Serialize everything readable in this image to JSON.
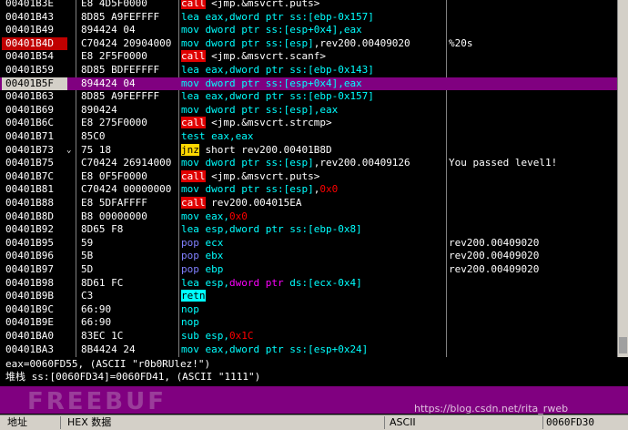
{
  "disasm": [
    {
      "addr": "00401B3E",
      "hex": "E8 4D5F0000",
      "ins": [
        [
          "k-call",
          "call"
        ],
        [
          "t",
          " <jmp.&msvcrt.puts>"
        ]
      ],
      "cmt": ""
    },
    {
      "addr": "00401B43",
      "hex": "8D85 A9FEFFFF",
      "ins": [
        [
          "k-lea",
          "lea"
        ],
        [
          "reg",
          " eax,dword ptr ss:[ebp-0x157]"
        ]
      ],
      "cmt": ""
    },
    {
      "addr": "00401B49",
      "hex": "894424 04",
      "ins": [
        [
          "k",
          "mov"
        ],
        [
          "reg",
          " dword ptr ss:[esp+0x4],eax"
        ]
      ],
      "cmt": ""
    },
    {
      "addr": "00401B4D",
      "hex": "C70424 20904000",
      "ins": [
        [
          "k",
          "mov"
        ],
        [
          "reg",
          " dword ptr ss:[esp]"
        ],
        [
          "t",
          ",rev200.00409020"
        ]
      ],
      "cmt": "%20s",
      "bp": true
    },
    {
      "addr": "00401B54",
      "hex": "E8 2F5F0000",
      "ins": [
        [
          "k-call",
          "call"
        ],
        [
          "t",
          " <jmp.&msvcrt.scanf>"
        ]
      ],
      "cmt": ""
    },
    {
      "addr": "00401B59",
      "hex": "8D85 BDFEFFFF",
      "ins": [
        [
          "k-lea",
          "lea"
        ],
        [
          "reg",
          " eax,dword ptr ss:[ebp-0x143]"
        ]
      ],
      "cmt": ""
    },
    {
      "addr": "00401B5F",
      "hex": "894424 04",
      "ins": [
        [
          "k",
          "mov"
        ],
        [
          "reg",
          " dword ptr ss:[esp+0x4],eax"
        ]
      ],
      "cmt": "",
      "sel": true,
      "cur": true
    },
    {
      "addr": "00401B63",
      "hex": "8D85 A9FEFFFF",
      "ins": [
        [
          "k-lea",
          "lea"
        ],
        [
          "reg",
          " eax,dword ptr ss:[ebp-0x157]"
        ]
      ],
      "cmt": ""
    },
    {
      "addr": "00401B69",
      "hex": "890424",
      "ins": [
        [
          "k",
          "mov"
        ],
        [
          "reg",
          " dword ptr ss:[esp],eax"
        ]
      ],
      "cmt": ""
    },
    {
      "addr": "00401B6C",
      "hex": "E8 275F0000",
      "ins": [
        [
          "k-call",
          "call"
        ],
        [
          "t",
          " <jmp.&msvcrt.strcmp>"
        ]
      ],
      "cmt": ""
    },
    {
      "addr": "00401B71",
      "hex": "85C0",
      "ins": [
        [
          "k",
          "test"
        ],
        [
          "reg",
          " eax,eax"
        ]
      ],
      "cmt": ""
    },
    {
      "addr": "00401B73",
      "hex": "75 18",
      "arrow": "⌄",
      "ins": [
        [
          "k-jmp",
          "jnz"
        ],
        [
          "t",
          " short rev200.00401B8D"
        ]
      ],
      "cmt": ""
    },
    {
      "addr": "00401B75",
      "hex": "C70424 26914000",
      "ins": [
        [
          "k",
          "mov"
        ],
        [
          "reg",
          " dword ptr ss:[esp]"
        ],
        [
          "t",
          ",rev200.00409126"
        ]
      ],
      "cmt": "You passed level1!"
    },
    {
      "addr": "00401B7C",
      "hex": "E8 0F5F0000",
      "ins": [
        [
          "k-call",
          "call"
        ],
        [
          "t",
          " <jmp.&msvcrt.puts>"
        ]
      ],
      "cmt": ""
    },
    {
      "addr": "00401B81",
      "hex": "C70424 00000000",
      "ins": [
        [
          "k",
          "mov"
        ],
        [
          "reg",
          " dword ptr ss:[esp]"
        ],
        [
          "t",
          ","
        ],
        [
          "n",
          "0x0"
        ]
      ],
      "cmt": ""
    },
    {
      "addr": "00401B88",
      "hex": "E8 5DFAFFFF",
      "ins": [
        [
          "k-call",
          "call"
        ],
        [
          "t",
          " rev200.004015EA"
        ]
      ],
      "cmt": ""
    },
    {
      "addr": "00401B8D",
      "hex": "B8 00000000",
      "ins": [
        [
          "k",
          "mov"
        ],
        [
          "reg",
          " eax,"
        ],
        [
          "n",
          "0x0"
        ]
      ],
      "cmt": ""
    },
    {
      "addr": "00401B92",
      "hex": "8D65 F8",
      "ins": [
        [
          "k-lea",
          "lea"
        ],
        [
          "reg",
          " esp,dword ptr ss:[ebp-0x8]"
        ]
      ],
      "cmt": ""
    },
    {
      "addr": "00401B95",
      "hex": "59",
      "ins": [
        [
          "k-pop",
          "pop"
        ],
        [
          "reg",
          " ecx"
        ]
      ],
      "cmt": "rev200.00409020"
    },
    {
      "addr": "00401B96",
      "hex": "5B",
      "ins": [
        [
          "k-pop",
          "pop"
        ],
        [
          "reg",
          " ebx"
        ]
      ],
      "cmt": "rev200.00409020"
    },
    {
      "addr": "00401B97",
      "hex": "5D",
      "ins": [
        [
          "k-pop",
          "pop"
        ],
        [
          "reg",
          " ebp"
        ]
      ],
      "cmt": "rev200.00409020"
    },
    {
      "addr": "00401B98",
      "hex": "8D61 FC",
      "ins": [
        [
          "k-lea",
          "lea"
        ],
        [
          "reg",
          " esp,"
        ],
        [
          "kw",
          "dword ptr"
        ],
        [
          "reg",
          " ds:[ecx-0x4]"
        ]
      ],
      "cmt": ""
    },
    {
      "addr": "00401B9B",
      "hex": "C3",
      "ins": [
        [
          "k-ret",
          "retn"
        ]
      ],
      "cmt": ""
    },
    {
      "addr": "00401B9C",
      "hex": "66:90",
      "ins": [
        [
          "k",
          "nop"
        ]
      ],
      "cmt": ""
    },
    {
      "addr": "00401B9E",
      "hex": "66:90",
      "ins": [
        [
          "k",
          "nop"
        ]
      ],
      "cmt": ""
    },
    {
      "addr": "00401BA0",
      "hex": "83EC 1C",
      "ins": [
        [
          "k",
          "sub"
        ],
        [
          "reg",
          " esp,"
        ],
        [
          "n",
          "0x1C"
        ]
      ],
      "cmt": ""
    },
    {
      "addr": "00401BA3",
      "hex": "8B4424 24",
      "ins": [
        [
          "k",
          "mov"
        ],
        [
          "reg",
          " eax,dword ptr ss:[esp+0x24]"
        ]
      ],
      "cmt": ""
    }
  ],
  "info": {
    "line1": "eax=0060FD55, (ASCII \"r0b0RUlez!\")",
    "line2_prefix": "堆栈",
    "line2": " ss:[0060FD34]=0060FD41, (ASCII \"1111\")"
  },
  "watermark": {
    "text": "FREEBUF",
    "url": "https://blog.csdn.net/rita_rweb"
  },
  "tabs": {
    "t1": "地址",
    "t2": "HEX 数据",
    "t3": "ASCII",
    "t4": "0060FD30"
  }
}
